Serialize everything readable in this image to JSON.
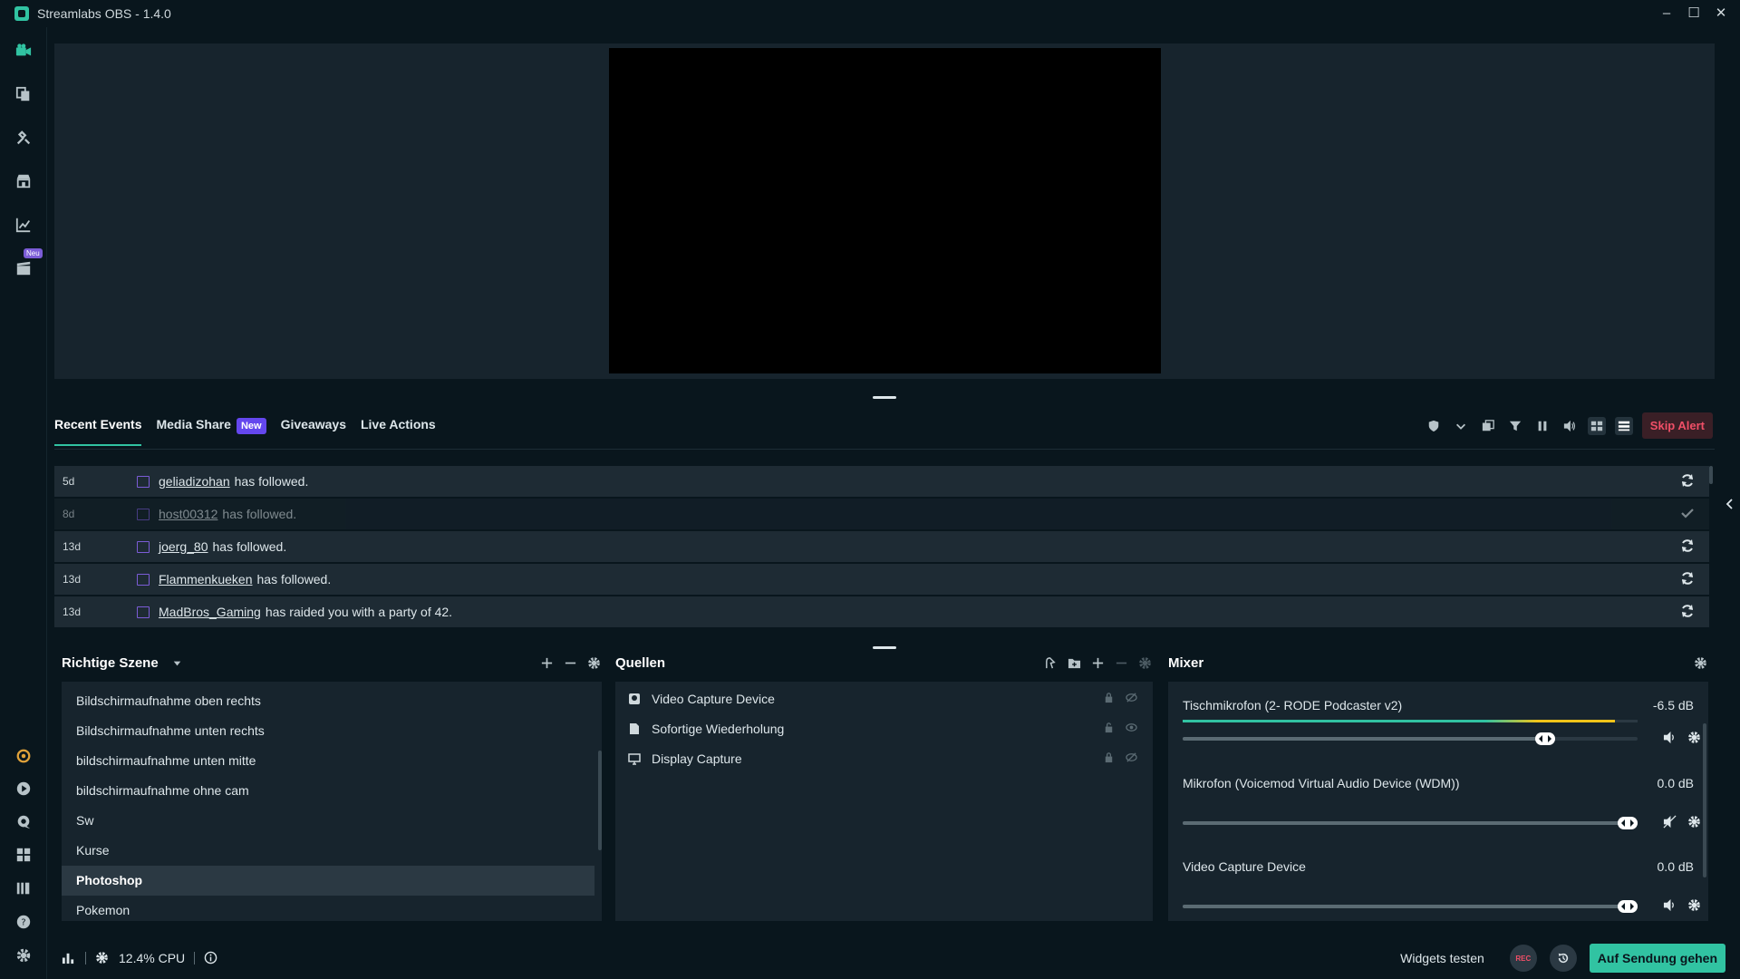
{
  "window": {
    "title": "Streamlabs OBS - 1.4.0",
    "minimize": "–",
    "maximize": "☐",
    "close": "✕"
  },
  "nav": {
    "neu_badge": "Neu",
    "top_icons": [
      "studio-camera-icon",
      "themes-icon",
      "app-store-icon",
      "store-icon",
      "analytics-icon",
      "new-feature-icon"
    ],
    "bottom_icons": [
      "prime-icon",
      "play-icon",
      "chat-icon",
      "layout-icon",
      "library-icon",
      "help-icon",
      "settings-icon"
    ]
  },
  "events": {
    "tabs": [
      {
        "label": "Recent Events",
        "active": true
      },
      {
        "label": "Media Share",
        "badge": "New"
      },
      {
        "label": "Giveaways"
      },
      {
        "label": "Live Actions"
      }
    ],
    "skip_alert": "Skip Alert",
    "rows": [
      {
        "time": "5d",
        "user": "geliadizohan",
        "text": "has followed.",
        "action": "repeat",
        "faded": false
      },
      {
        "time": "8d",
        "user": "host00312",
        "text": "has followed.",
        "action": "check",
        "faded": true
      },
      {
        "time": "13d",
        "user": "joerg_80",
        "text": "has followed.",
        "action": "repeat",
        "faded": false
      },
      {
        "time": "13d",
        "user": "Flammenkueken",
        "text": "has followed.",
        "action": "repeat",
        "faded": false
      },
      {
        "time": "13d",
        "user": "MadBros_Gaming",
        "text": "has raided you with a party of 42.",
        "action": "repeat",
        "faded": false
      }
    ]
  },
  "scenes": {
    "title": "Richtige Szene",
    "items": [
      {
        "label": "Bildschirmaufnahme oben rechts"
      },
      {
        "label": "Bildschirmaufnahme unten rechts"
      },
      {
        "label": "bildschirmaufnahme unten mitte"
      },
      {
        "label": "bildschirmaufnahme ohne cam"
      },
      {
        "label": "Sw"
      },
      {
        "label": "Kurse"
      },
      {
        "label": "Photoshop",
        "active": true
      },
      {
        "label": "Pokemon"
      }
    ]
  },
  "sources": {
    "title": "Quellen",
    "items": [
      {
        "label": "Video Capture Device",
        "icon": "webcam-icon"
      },
      {
        "label": "Sofortige Wiederholung",
        "icon": "file-icon"
      },
      {
        "label": "Display Capture",
        "icon": "monitor-icon"
      }
    ]
  },
  "mixer": {
    "title": "Mixer",
    "items": [
      {
        "name": "Tischmikrofon (2- RODE Podcaster v2)",
        "db": "-6.5 dB",
        "level": 0.81,
        "meter": 0.95
      },
      {
        "name": "Mikrofon (Voicemod Virtual Audio Device (WDM))",
        "db": "0.0 dB",
        "level": 1.0,
        "meter": 0
      },
      {
        "name": "Video Capture Device",
        "db": "0.0 dB",
        "level": 1.0,
        "meter": 0
      }
    ]
  },
  "footer": {
    "cpu": "12.4% CPU",
    "widgets_test": "Widgets testen",
    "rec": "REC",
    "go_live": "Auf Sendung gehen"
  },
  "colors": {
    "accent": "#31c3a2",
    "background": "#09161d",
    "panel": "#17242d",
    "danger": "#f04f67",
    "badge": "#6447ee"
  }
}
